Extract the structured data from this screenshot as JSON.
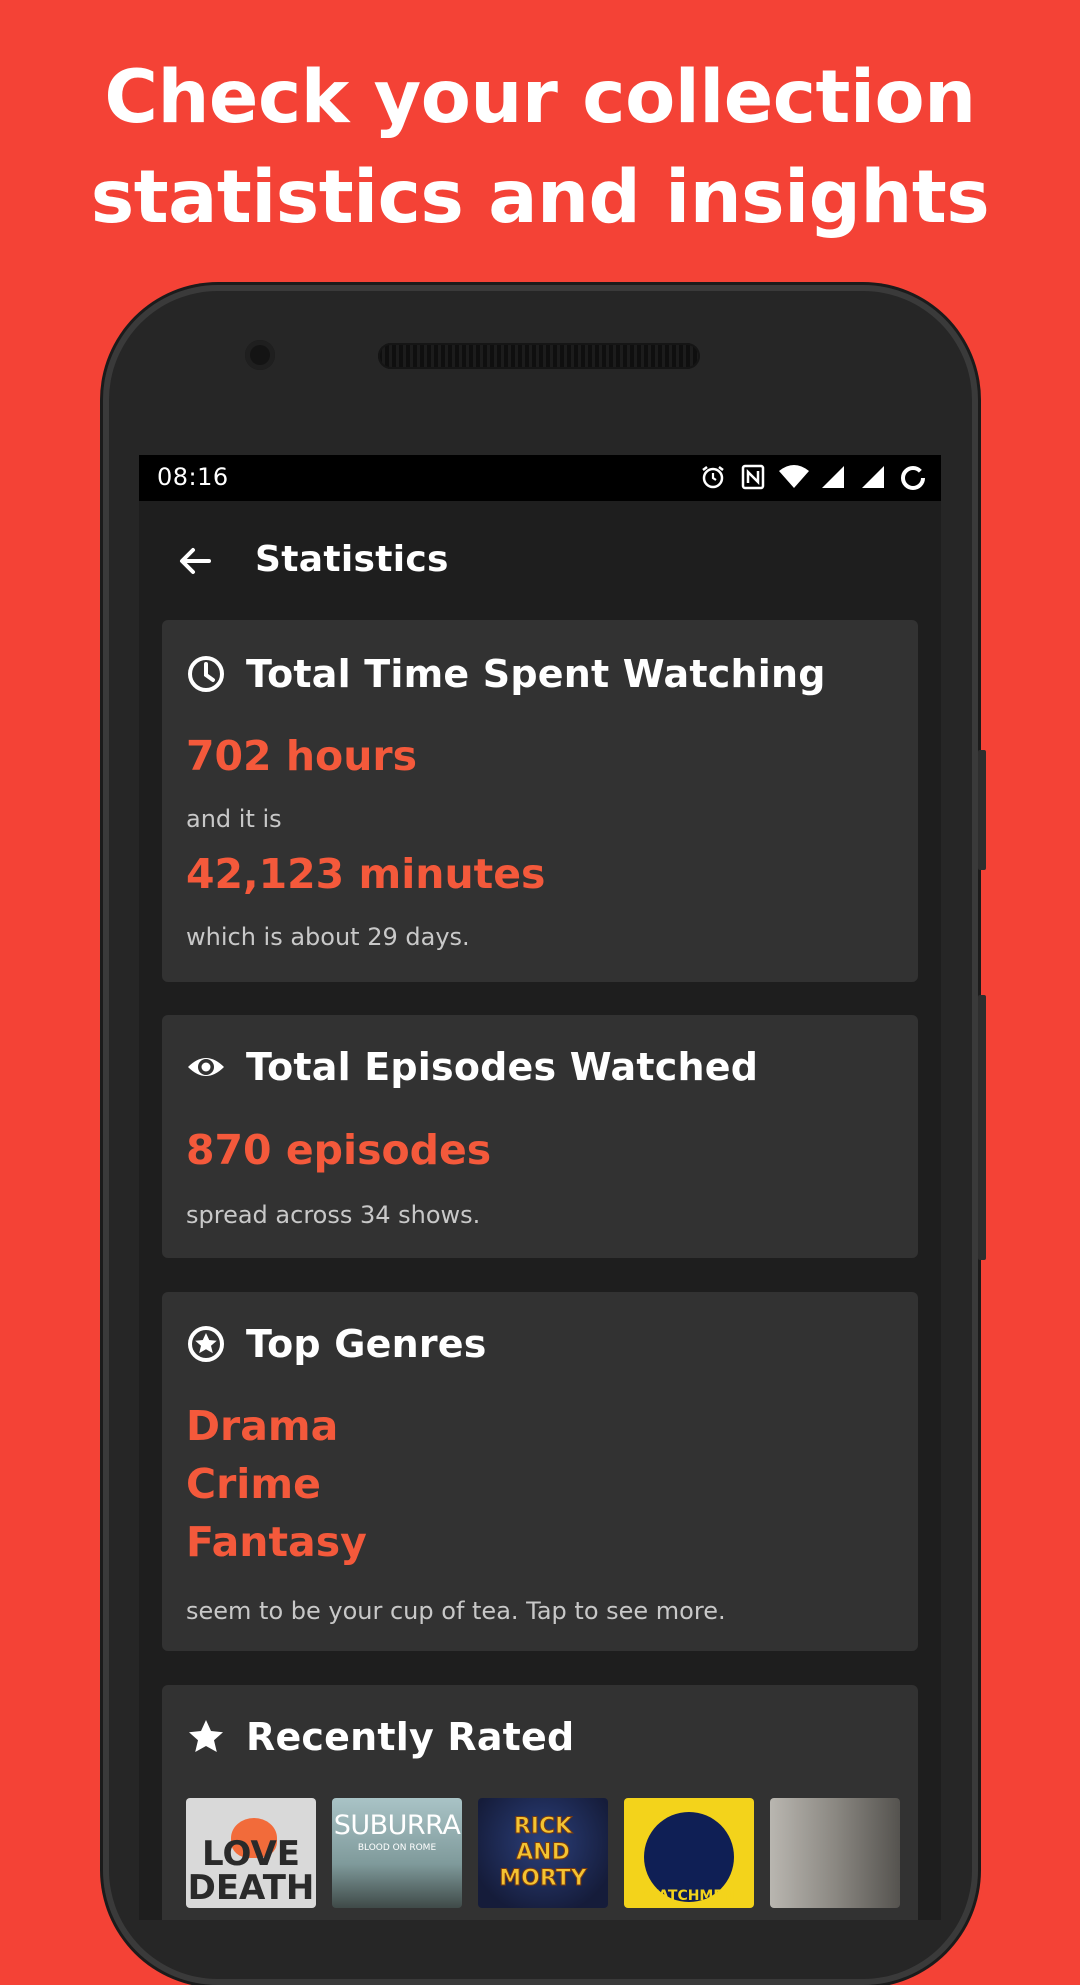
{
  "headline": {
    "line1": "Check your collection",
    "line2": "statistics and insights"
  },
  "status_bar": {
    "time": "08:16",
    "icons": [
      "alarm-icon",
      "nfc-icon",
      "wifi-icon",
      "signal-icon",
      "signal-icon",
      "battery-saver-icon"
    ]
  },
  "toolbar": {
    "back_icon": "arrow-back-icon",
    "title": "Statistics"
  },
  "cards": {
    "time": {
      "icon": "clock-icon",
      "title": "Total Time Spent Watching",
      "hours": "702 hours",
      "connector": "and it is",
      "minutes": "42,123 minutes",
      "note": "which is about 29 days."
    },
    "episodes": {
      "icon": "eye-icon",
      "title": "Total Episodes Watched",
      "count": "870 episodes",
      "note": "spread across 34 shows."
    },
    "genres": {
      "icon": "star-circle-icon",
      "title": "Top Genres",
      "items": [
        "Drama",
        "Crime",
        "Fantasy"
      ],
      "note": "seem to be your cup of tea. Tap to see more."
    },
    "rated": {
      "icon": "star-icon",
      "title": "Recently Rated",
      "posters": [
        {
          "text": "LOVE\nDEATH"
        },
        {
          "text": "SUBURRA",
          "sub": "BLOOD ON ROME"
        },
        {
          "text": "RICK\nAND\nMORTY"
        },
        {
          "text": "WATCHMEN"
        },
        {
          "text": ""
        }
      ]
    }
  },
  "colors": {
    "background": "#f44236",
    "accent": "#f4593b",
    "card": "#323232",
    "screen": "#1e1e1e"
  }
}
